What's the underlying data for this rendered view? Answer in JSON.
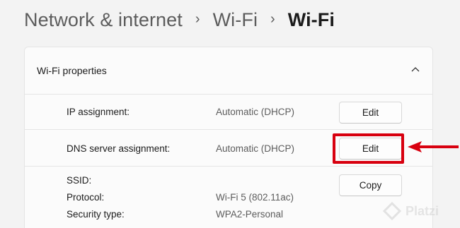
{
  "breadcrumb": {
    "items": [
      "Network & internet",
      "Wi-Fi"
    ],
    "current": "Wi-Fi",
    "separator": "›"
  },
  "card": {
    "title": "Wi-Fi properties",
    "rows": {
      "ip": {
        "label": "IP assignment:",
        "value": "Automatic (DHCP)",
        "button": "Edit"
      },
      "dns": {
        "label": "DNS server assignment:",
        "value": "Automatic (DHCP)",
        "button": "Edit"
      },
      "details": {
        "ssid_label": "SSID:",
        "protocol_label": "Protocol:",
        "protocol_value": "Wi-Fi 5 (802.11ac)",
        "security_label": "Security type:",
        "security_value": "WPA2-Personal",
        "button": "Copy"
      }
    }
  },
  "annotation": {
    "color": "#d8000f"
  },
  "watermark": {
    "text": "Platzi"
  }
}
